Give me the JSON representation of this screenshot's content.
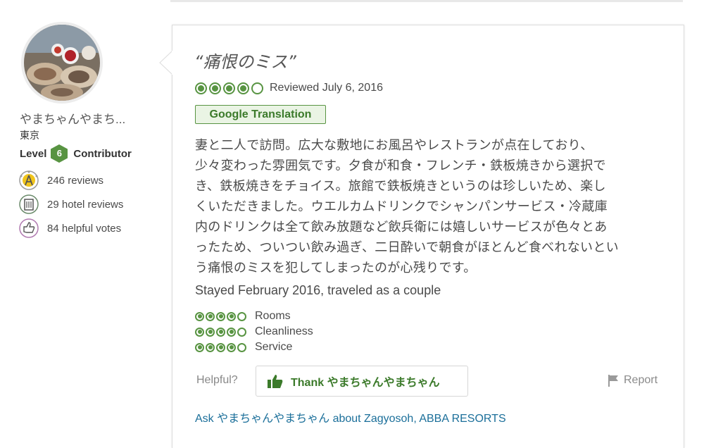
{
  "user": {
    "name": "やまちゃんやまち...",
    "location": "東京",
    "level_prefix": "Level",
    "level": "6",
    "level_suffix": "Contributor",
    "stats": [
      {
        "icon": "reviews-icon",
        "text": "246 reviews"
      },
      {
        "icon": "hotel-icon",
        "text": "29 hotel reviews"
      },
      {
        "icon": "helpful-votes-icon",
        "text": "84 helpful votes"
      }
    ]
  },
  "review": {
    "title": "“痛恨のミス”",
    "rating": 4,
    "rating_max": 5,
    "reviewed": "Reviewed July 6, 2016",
    "translate_label": "Google Translation",
    "text_lines": [
      "妻と二人で訪問。広大な敷地にお風呂やレストランが点在しており、",
      "少々変わった雰囲気です。夕食が和食・フレンチ・鉄板焼きから選択で",
      "き、鉄板焼きをチョイス。旅館で鉄板焼きというのは珍しいため、楽し",
      "くいただきました。ウエルカムドリンクでシャンパンサービス・冷蔵庫",
      "内のドリンクは全て飲み放題など飲兵衛には嬉しいサービスが色々とあ",
      "ったため、ついつい飲み過ぎ、二日酔いで朝食がほとんど食べれないとい",
      "う痛恨のミスを犯してしまったのが心残りです。"
    ],
    "stayed": "Stayed February 2016, traveled as a couple",
    "sub_ratings": [
      {
        "label": "Rooms",
        "value": 4
      },
      {
        "label": "Cleanliness",
        "value": 4
      },
      {
        "label": "Service",
        "value": 4
      }
    ],
    "helpful_label": "Helpful?",
    "thank_label": "Thank やまちゃんやまちゃん",
    "report_label": "Report",
    "ask_label": "Ask やまちゃんやまちゃん about Zagyosoh, ABBA RESORTS"
  },
  "colors": {
    "accent_green": "#589442",
    "link_blue": "#1b6f9a"
  }
}
